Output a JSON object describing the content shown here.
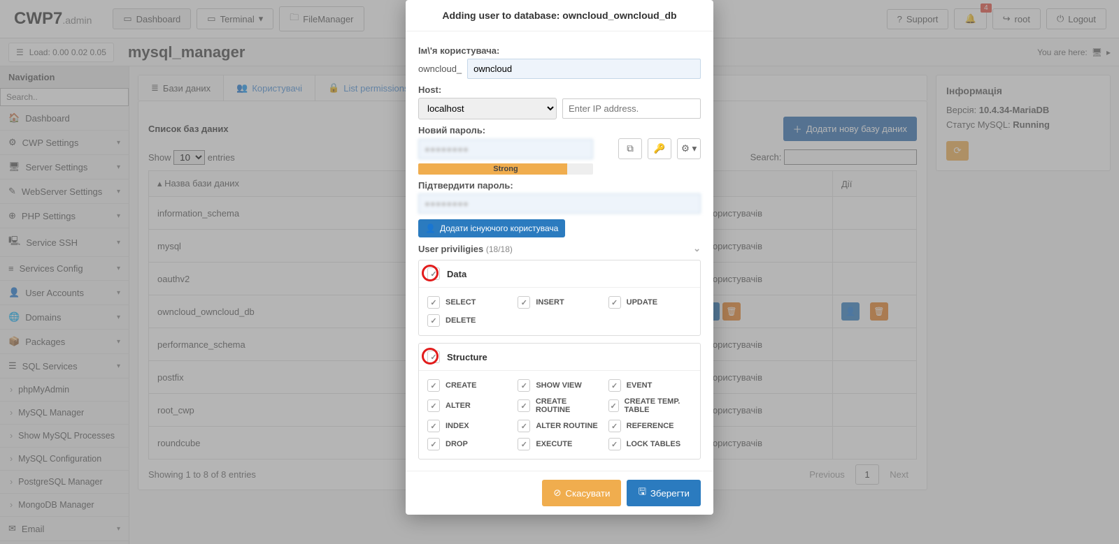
{
  "brand": {
    "main": "CWP7",
    "sub": ".admin"
  },
  "topbar": {
    "dashboard": "Dashboard",
    "terminal": "Terminal",
    "filemanager": "FileManager",
    "support": "Support",
    "notif_count": "4",
    "root": "root",
    "logout": "Logout"
  },
  "loadbar": {
    "load_label": "Load: 0.00  0.02  0.05",
    "title": "mysql_manager",
    "youhere": "You are here:"
  },
  "sidebar": {
    "header": "Navigation",
    "search_ph": "Search..",
    "items": [
      {
        "icon": "🏠",
        "label": "Dashboard",
        "expand": false
      },
      {
        "icon": "⚙",
        "label": "CWP Settings",
        "expand": true
      },
      {
        "icon": "🖥",
        "label": "Server Settings",
        "expand": true
      },
      {
        "icon": "✎",
        "label": "WebServer Settings",
        "expand": true
      },
      {
        "icon": "⊕",
        "label": "PHP Settings",
        "expand": true
      },
      {
        "icon": "🖳",
        "label": "Service SSH",
        "expand": true
      },
      {
        "icon": "≡",
        "label": "Services Config",
        "expand": true
      },
      {
        "icon": "👤",
        "label": "User Accounts",
        "expand": true
      },
      {
        "icon": "🌐",
        "label": "Domains",
        "expand": true
      },
      {
        "icon": "📦",
        "label": "Packages",
        "expand": true
      },
      {
        "icon": "☰",
        "label": "SQL Services",
        "expand": true
      }
    ],
    "subitems": [
      "phpMyAdmin",
      "MySQL Manager",
      "Show MySQL Processes",
      "MySQL Configuration",
      "PostgreSQL Manager",
      "MongoDB Manager"
    ],
    "email": "Email"
  },
  "tabs": {
    "db": "Бази даних",
    "users": "Користувачі",
    "perms": "List permissions"
  },
  "main": {
    "list_title": "Список баз даних",
    "add_db": "Додати нову базу даних",
    "show": "Show",
    "entries": "entries",
    "search": "Search:",
    "col_name": "Назва бази даних",
    "col_actions": "Дії",
    "user_cell": "х користувачів",
    "rows": [
      "information_schema",
      "mysql",
      "oauthv2",
      "owncloud_owncloud_db",
      "performance_schema",
      "postfix",
      "root_cwp",
      "roundcube"
    ],
    "showing": "Showing 1 to 8 of 8 entries",
    "prev": "Previous",
    "page": "1",
    "next": "Next"
  },
  "info": {
    "title": "Інформація",
    "version_label": "Версія:",
    "version": "10.4.34-MariaDB",
    "status_label": "Статус MySQL:",
    "status": "Running"
  },
  "modal": {
    "title": "Adding user to database: owncloud_owncloud_db",
    "username_label": "Ім\\'я користувача:",
    "prefix": "owncloud_",
    "username_value": "owncloud",
    "host_label": "Host:",
    "host_value": "localhost",
    "ip_ph": "Enter IP address.",
    "newpw_label": "Новий пароль:",
    "strength": "Strong",
    "confirm_label": "Підтвердити пароль:",
    "add_existing": "Додати існуючого користувача",
    "privs_label": "User priviligies",
    "privs_count": "(18/18)",
    "data_label": "Data",
    "data_privs": [
      "SELECT",
      "INSERT",
      "UPDATE",
      "DELETE"
    ],
    "struct_label": "Structure",
    "struct_privs": [
      "CREATE",
      "SHOW VIEW",
      "EVENT",
      "ALTER",
      "CREATE ROUTINE",
      "CREATE TEMP. TABLE",
      "INDEX",
      "ALTER ROUTINE",
      "REFERENCE",
      "DROP",
      "EXECUTE",
      "LOCK TABLES"
    ],
    "cancel": "Скасувати",
    "save": "Зберегти"
  }
}
